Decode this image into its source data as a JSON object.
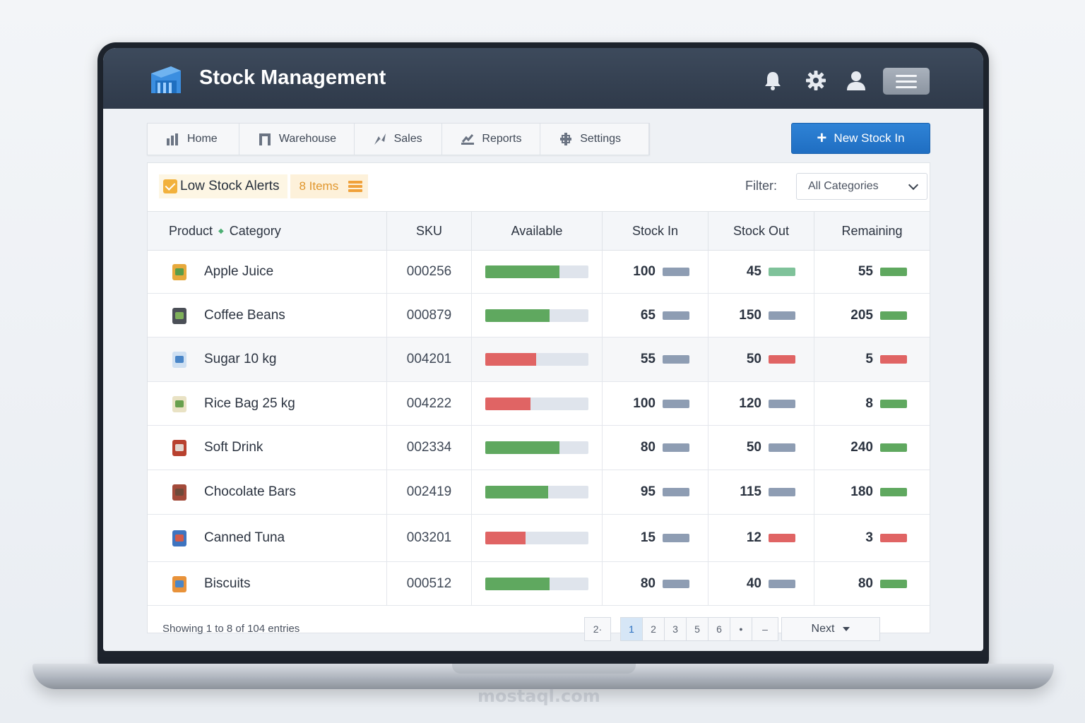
{
  "app": {
    "title": "Stock Management"
  },
  "header_icons": [
    "bell-icon",
    "gear-icon",
    "user-icon",
    "menu-icon"
  ],
  "nav": {
    "items": [
      {
        "label": "Home",
        "icon": "bar-chart-icon"
      },
      {
        "label": "Warehouse",
        "icon": "warehouse-icon"
      },
      {
        "label": "Sales",
        "icon": "sales-icon"
      },
      {
        "label": "Reports",
        "icon": "reports-icon"
      },
      {
        "label": "Settings",
        "icon": "settings-icon"
      }
    ],
    "new_button": "New Stock In"
  },
  "alerts": {
    "label": "Low Stock Alerts",
    "count": "8 Items"
  },
  "filter": {
    "label": "Filter:",
    "value": "All Categories"
  },
  "table": {
    "headers": {
      "product": "Product",
      "category": "Category",
      "sku": "SKU",
      "available": "Available",
      "stock_in": "Stock In",
      "stock_out": "Stock Out",
      "remaining": "Remaining"
    },
    "rows": [
      {
        "product": "Apple Juice",
        "icon": "juice-icon",
        "sku": "000256",
        "available": 0.72,
        "status": "ok",
        "stock_in": "100",
        "stock_out": "45",
        "stock_out_status": "ok",
        "remaining": "55",
        "remaining_status": "ok"
      },
      {
        "product": "Coffee Beans",
        "icon": "coffee-icon",
        "sku": "000879",
        "available": 0.62,
        "status": "ok",
        "stock_in": "65",
        "stock_out": "150",
        "stock_out_status": "neutral",
        "remaining": "205",
        "remaining_status": "ok"
      },
      {
        "product": "Sugar 10 kg",
        "icon": "sugar-icon",
        "sku": "004201",
        "available": 0.49,
        "status": "low",
        "stock_in": "55",
        "stock_out": "50",
        "stock_out_status": "low",
        "remaining": "5",
        "remaining_status": "low"
      },
      {
        "product": "Rice Bag 25 kg",
        "icon": "rice-icon",
        "sku": "004222",
        "available": 0.44,
        "status": "low",
        "stock_in": "100",
        "stock_out": "120",
        "stock_out_status": "neutral",
        "remaining": "8",
        "remaining_status": "ok"
      },
      {
        "product": "Soft Drink",
        "icon": "drink-icon",
        "sku": "002334",
        "available": 0.72,
        "status": "ok",
        "stock_in": "80",
        "stock_out": "50",
        "stock_out_status": "neutral",
        "remaining": "240",
        "remaining_status": "ok"
      },
      {
        "product": "Chocolate Bars",
        "icon": "chocolate-icon",
        "sku": "002419",
        "available": 0.61,
        "status": "ok",
        "stock_in": "95",
        "stock_out": "115",
        "stock_out_status": "neutral",
        "remaining": "180",
        "remaining_status": "ok"
      },
      {
        "product": "Canned Tuna",
        "icon": "tuna-icon",
        "sku": "003201",
        "available": 0.39,
        "status": "low",
        "stock_in": "15",
        "stock_out": "12",
        "stock_out_status": "low",
        "remaining": "3",
        "remaining_status": "low"
      },
      {
        "product": "Biscuits",
        "icon": "biscuits-icon",
        "sku": "000512",
        "available": 0.62,
        "status": "ok",
        "stock_in": "80",
        "stock_out": "40",
        "stock_out_status": "neutral",
        "remaining": "80",
        "remaining_status": "ok"
      }
    ]
  },
  "footer": {
    "showing": "Showing 1 to 8 of 104 entries",
    "first": "2·",
    "pages": [
      "1",
      "2",
      "3",
      "5",
      "6"
    ],
    "active_page": "1",
    "dot": "●",
    "dash": "–",
    "next": "Next"
  },
  "colors": {
    "ok": "#5fa85f",
    "low": "#e06464",
    "neutral": "#8e9db3",
    "ok_light": "#7fc29a",
    "accent": "#2475cb"
  },
  "watermark": "mostaql.com"
}
